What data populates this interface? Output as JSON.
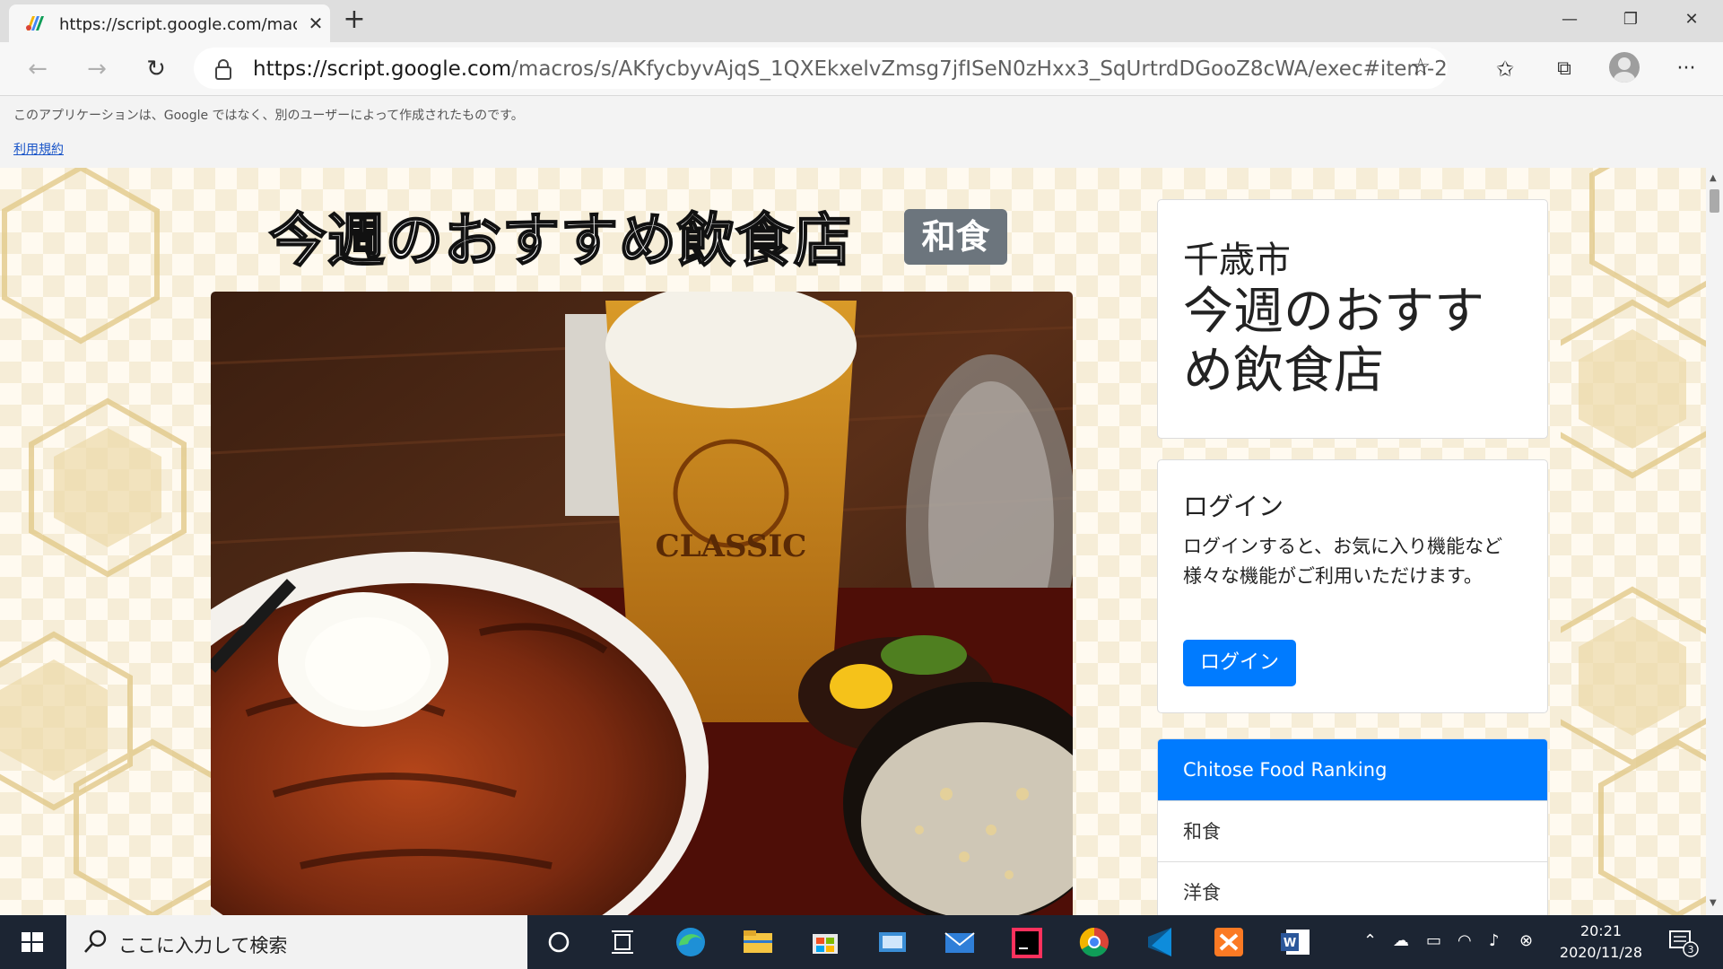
{
  "browser": {
    "tab_title": "https://script.google.com/macros/s/AKfycbyvAjqS_1QXEkxelvZmsg7jfISeN0zHxx3_SqUrtrdDGooZ8cWA/exec#item-2",
    "url_host": "https://script.google.com",
    "url_path": "/macros/s/AKfycbyvAjqS_1QXEkxelvZmsg7jfISeN0zHxx3_SqUrtrdDGooZ8cWA/exec#item-2"
  },
  "apps_script": {
    "note": "このアプリケーションは、Google ではなく、別のユーザーによって作成されたものです。",
    "terms_link": "利用規約"
  },
  "main": {
    "title": "今週のおすすめ飲食店",
    "badge": "和食",
    "photo_text": "CLASSIC"
  },
  "sidebar": {
    "city": "千歳市",
    "city_title": "今週のおすすめ飲食店",
    "login": {
      "heading": "ログイン",
      "text": "ログインすると、お気に入り機能など様々な機能がご利用いただけます。",
      "button": "ログイン"
    },
    "ranking": {
      "header": "Chitose Food Ranking",
      "items": [
        "和食",
        "洋食"
      ]
    }
  },
  "taskbar": {
    "search_placeholder": "ここに入力して検索",
    "time": "20:21",
    "date": "2020/11/28",
    "notification_count": "3"
  },
  "colors": {
    "primary": "#007bff",
    "badge": "#6c757d",
    "taskbar": "#1c2533"
  }
}
